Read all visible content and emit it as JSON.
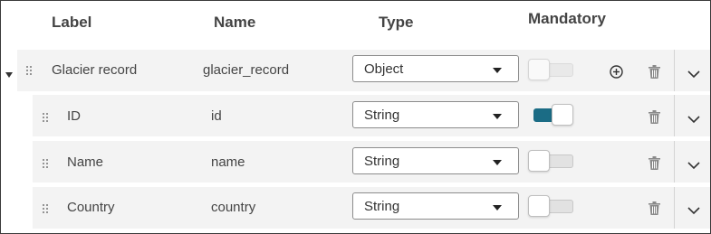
{
  "header": {
    "label": "Label",
    "name": "Name",
    "type": "Type",
    "mandatory": "Mandatory"
  },
  "rows": [
    {
      "label": "Glacier record",
      "name": "glacier_record",
      "type": "Object",
      "mandatory": false
    },
    {
      "label": "ID",
      "name": "id",
      "type": "String",
      "mandatory": true
    },
    {
      "label": "Name",
      "name": "name",
      "type": "String",
      "mandatory": false
    },
    {
      "label": "Country",
      "name": "country",
      "type": "String",
      "mandatory": false
    }
  ],
  "colors": {
    "accent": "#1b6c85",
    "row_bg": "#f3f3f3"
  },
  "icons": [
    "collapse-arrow-icon",
    "drag-handle-icon",
    "chevron-down-icon",
    "plus-circle-icon",
    "trash-icon"
  ]
}
